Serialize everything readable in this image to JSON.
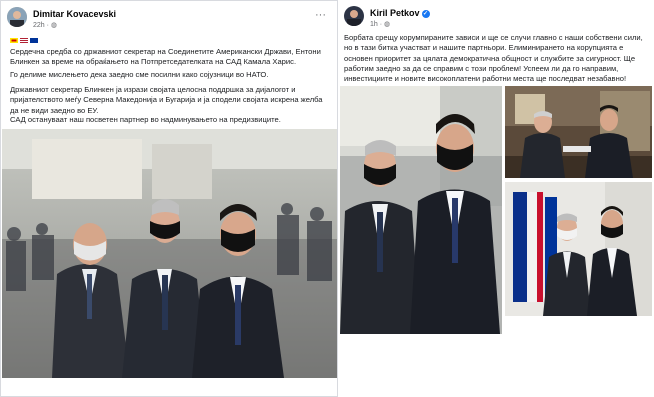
{
  "left_post": {
    "author": "Dimitar Kovacevski",
    "time": "22h",
    "paragraphs": [
      "Сердечна средба со државниот секретар на Соединетите Американски Држави, Ентони Блинкен за време на обраќањето на Потпретседателката на САД Камала Харис.",
      "Го делиме мислењето дека заедно сме посилни како сојузници во НАТО.",
      "Државниот секретар Блинкен ја изрази својата целосна поддршка за дијалогот и пријателството меѓу Северна Македонија и Бугарија и ја сподели својата искрена желба да не види заедно во ЕУ.",
      "САД остануваат наш посветен партнер во надминувањето на предизвиците."
    ]
  },
  "right_post": {
    "author": "Kiril Petkov",
    "time": "1h",
    "text": "Борбата срещу корумпираните зависи и ще се случи главно с наши собствени сили, но в тази битка участват и нашите партньори. Елиминирането на корупцията е основен приоритет за цялата демократична общност и службите за сигурност. Ще работим заедно за да се справим с този проблем! Успеем ли да го направим, инвестициите и новите високоплатени работни места ще последват незабавно!"
  },
  "icons": {
    "more": "more-options-icon",
    "privacy": "globe-icon",
    "verified": "verified-badge-icon"
  },
  "colors": {
    "facebook_blue": "#1877f2",
    "suit_dark": "#23262d",
    "mask_black": "#111111"
  }
}
